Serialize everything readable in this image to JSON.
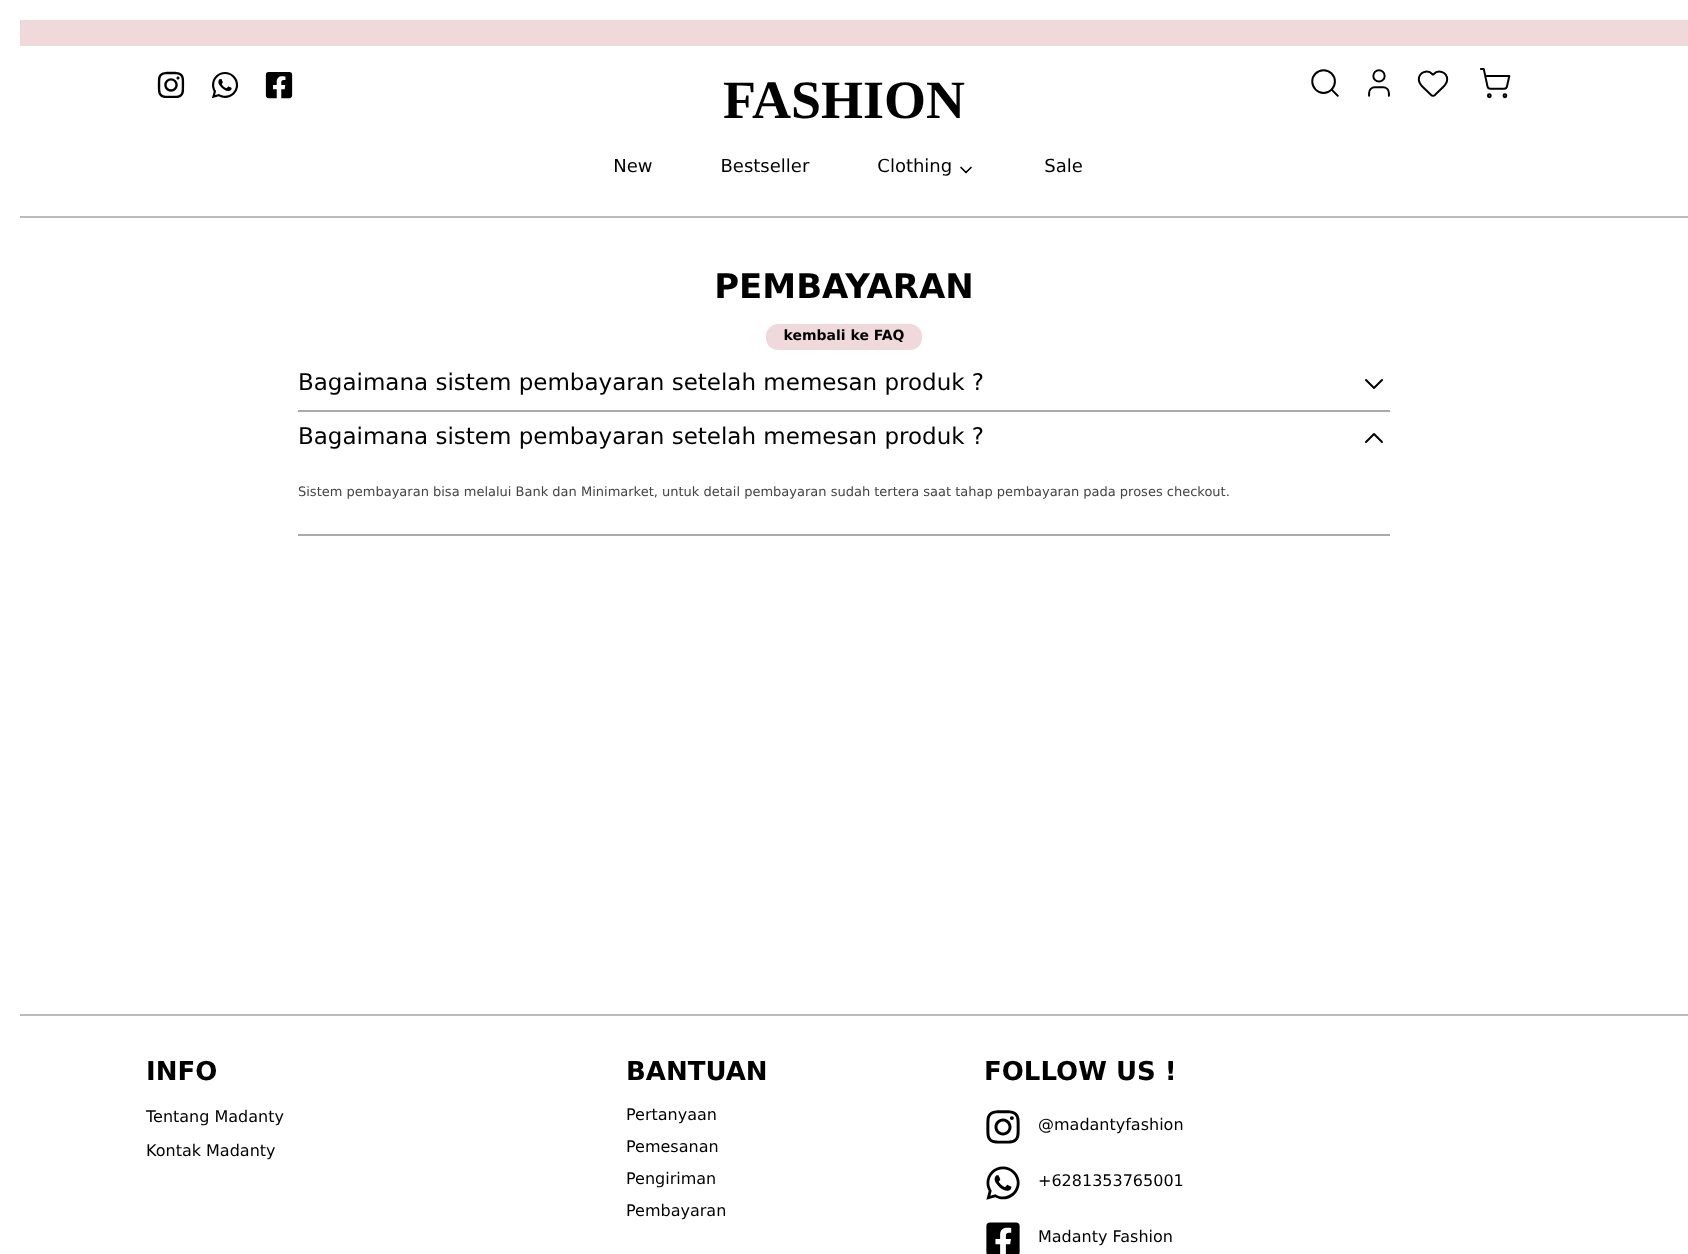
{
  "header": {
    "brand": "FASHION",
    "nav": [
      {
        "label": "New",
        "dropdown": false
      },
      {
        "label": "Bestseller",
        "dropdown": false
      },
      {
        "label": "Clothing",
        "dropdown": true
      },
      {
        "label": "Sale",
        "dropdown": false
      }
    ]
  },
  "page": {
    "title": "PEMBAYARAN",
    "back_button": "kembali ke FAQ"
  },
  "faq": [
    {
      "question": "Bagaimana sistem pembayaran setelah memesan produk ?",
      "expanded": false
    },
    {
      "question": "Bagaimana sistem pembayaran setelah memesan produk ?",
      "expanded": true,
      "answer": "Sistem pembayaran bisa melalui Bank dan Minimarket, untuk detail pembayaran sudah tertera saat tahap pembayaran pada proses checkout."
    }
  ],
  "footer": {
    "info": {
      "title": "INFO",
      "links": [
        "Tentang Madanty",
        "Kontak Madanty"
      ]
    },
    "help": {
      "title": "BANTUAN",
      "links": [
        "Pertanyaan",
        "Pemesanan",
        "Pengiriman",
        "Pembayaran"
      ]
    },
    "follow": {
      "title": "FOLLOW US !",
      "items": [
        {
          "kind": "instagram",
          "label": "@madantyfashion"
        },
        {
          "kind": "whatsapp",
          "label": "+6281353765001"
        },
        {
          "kind": "facebook",
          "label": "Madanty Fashion"
        }
      ]
    }
  }
}
